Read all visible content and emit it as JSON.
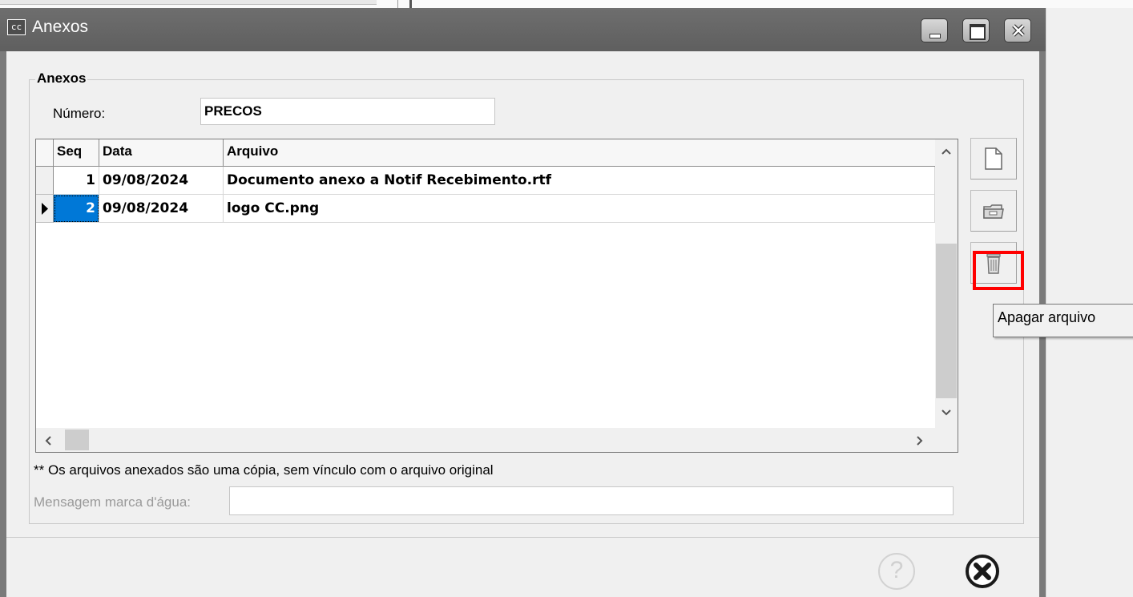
{
  "window": {
    "app_icon_text": "cc",
    "title": "Anexos"
  },
  "group": {
    "title": "Anexos",
    "numero_label": "Número:",
    "numero_value": "PRECOS"
  },
  "table": {
    "columns": [
      "Seq",
      "Data",
      "Arquivo"
    ],
    "rows": [
      {
        "seq": "1",
        "data": "09/08/2024",
        "arquivo": "Documento anexo a Notif Recebimento.rtf",
        "selected": false
      },
      {
        "seq": "2",
        "data": "09/08/2024",
        "arquivo": "logo CC.png",
        "selected": true
      }
    ]
  },
  "side_buttons": [
    {
      "name": "new-file",
      "icon": "document-icon"
    },
    {
      "name": "open-file",
      "icon": "folder-icon"
    },
    {
      "name": "delete-file",
      "icon": "trash-icon",
      "tooltip": "Apagar arquivo",
      "highlighted": true
    }
  ],
  "note": "** Os arquivos anexados são uma cópia, sem vínculo com o arquivo original",
  "watermark": {
    "label": "Mensagem marca d'água:",
    "value": ""
  },
  "footer": {
    "help_icon": "help-icon",
    "close_icon": "close-circle-icon"
  },
  "colors": {
    "titlebar": "#666666",
    "selection": "#0078d7",
    "highlight": "#ff0000"
  }
}
